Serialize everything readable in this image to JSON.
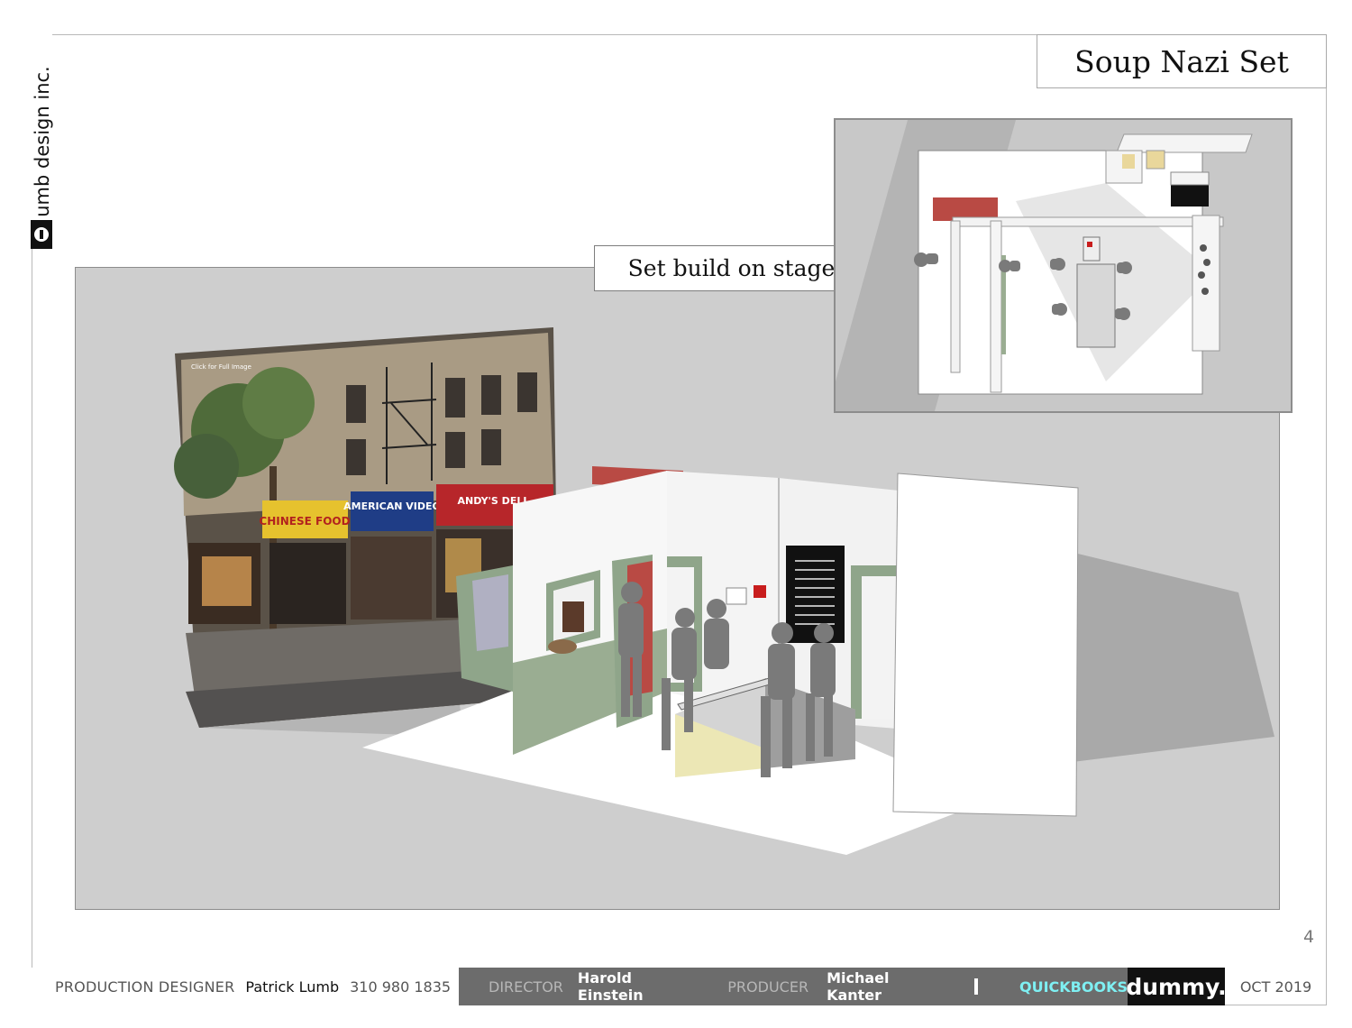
{
  "brand": {
    "name": "umb design inc.",
    "logo_icon": "lumb-l-logo"
  },
  "title": "Soup Nazi Set",
  "stage_label": "Set build on stage",
  "storefront_signs": {
    "click_label": "Click for Full Image",
    "chinese": "CHINESE FOOD",
    "american": "AMERICAN VIDEO",
    "andys": "ANDY'S DELI"
  },
  "page_number": "4",
  "footer": {
    "production_designer_label": "PRODUCTION DESIGNER",
    "production_designer_name": "Patrick Lumb",
    "phone": "310 980 1835",
    "director_label": "DIRECTOR",
    "director_name": "Harold Einstein",
    "producer_label": "PRODUCER",
    "producer_name": "Michael Kanter",
    "client": "QUICKBOOKS",
    "agency": "dummy.",
    "date": "OCT 2019"
  },
  "colors": {
    "stage_bg": "#cecece",
    "client_text": "#7ef0f3",
    "footer_mid": "#6c6c6c",
    "wall_green": "#9aad92",
    "brick": "#b94a44"
  }
}
